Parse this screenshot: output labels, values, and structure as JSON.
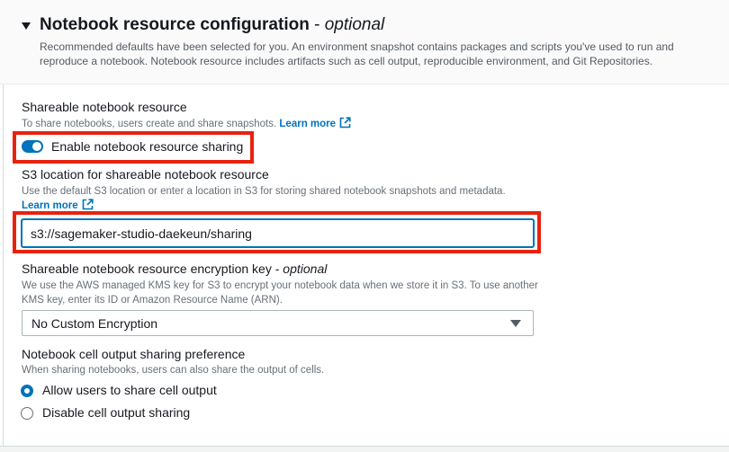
{
  "section": {
    "title": "Notebook resource configuration",
    "title_dash": "-",
    "title_optional": "optional",
    "description": "Recommended defaults have been selected for you. An environment snapshot contains packages and scripts you've used to run and reproduce a notebook. Notebook resource includes artifacts such as cell output, reproducible environment, and Git Repositories."
  },
  "sharing": {
    "label": "Shareable notebook resource",
    "description": "To share notebooks, users create and share snapshots.",
    "learn_more": "Learn more",
    "toggle_label": "Enable notebook resource sharing",
    "toggle_on": true
  },
  "s3": {
    "label": "S3 location for shareable notebook resource",
    "description": "Use the default S3 location or enter a location in S3 for storing shared notebook snapshots and metadata.",
    "learn_more": "Learn more",
    "value": "s3://sagemaker-studio-daekeun/sharing"
  },
  "encryption": {
    "label": "Shareable notebook resource encryption key",
    "label_dash": "-",
    "label_optional": "optional",
    "description": "We use the AWS managed KMS key for S3 to encrypt your notebook data when we store it in S3. To use another KMS key, enter its ID or Amazon Resource Name (ARN).",
    "selected": "No Custom Encryption"
  },
  "cell_output": {
    "label": "Notebook cell output sharing preference",
    "description": "When sharing notebooks, users can also share the output of cells.",
    "options": [
      {
        "label": "Allow users to share cell output",
        "checked": true
      },
      {
        "label": "Disable cell output sharing",
        "checked": false
      }
    ]
  },
  "colors": {
    "accent": "#0073bb",
    "highlight": "#e8220f",
    "text": "#16191f",
    "muted": "#687078"
  }
}
